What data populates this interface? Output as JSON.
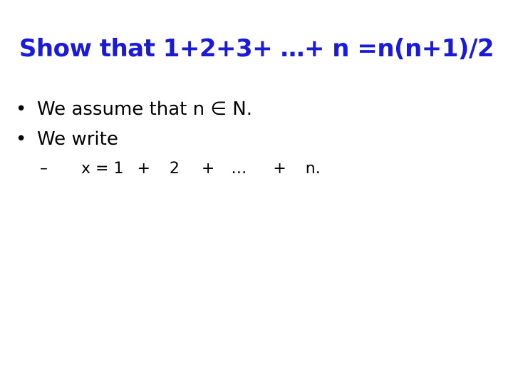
{
  "title": "Show that 1+2+3+ …+ n =n(n+1)/2",
  "bullets": [
    {
      "marker": "•",
      "text": "We assume that n ∈ N."
    },
    {
      "marker": "•",
      "text": "We write"
    }
  ],
  "sub_bullets": [
    {
      "marker": "–",
      "terms": [
        "x = 1",
        "+",
        "2",
        "+",
        "…",
        "+",
        "n."
      ]
    }
  ],
  "colors": {
    "title": "#1a1adb",
    "body": "#000000",
    "background": "#ffffff"
  }
}
